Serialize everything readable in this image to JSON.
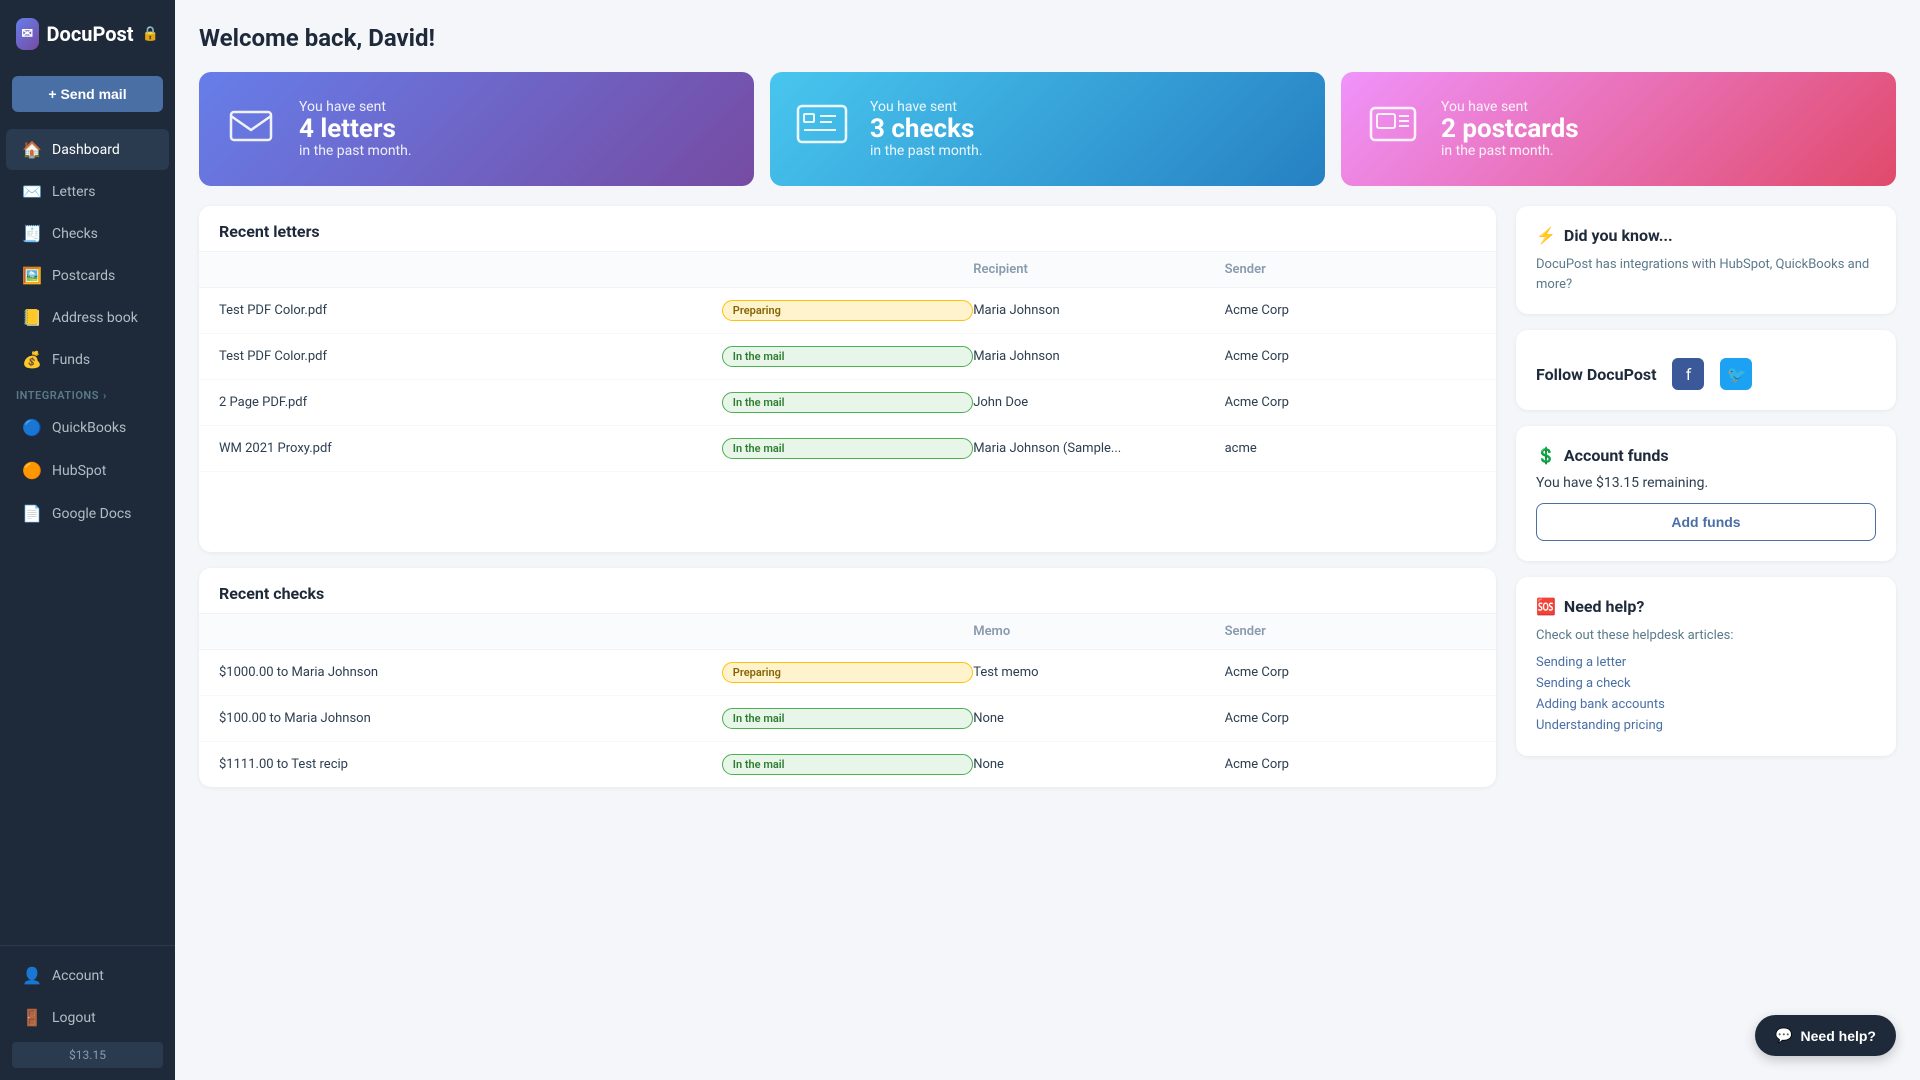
{
  "app": {
    "name": "DocuPost",
    "logo_text": "DocuPost"
  },
  "sidebar": {
    "send_mail_label": "+ Send mail",
    "nav_items": [
      {
        "id": "dashboard",
        "label": "Dashboard",
        "icon": "🏠",
        "active": true
      },
      {
        "id": "letters",
        "label": "Letters",
        "icon": "✉️",
        "active": false
      },
      {
        "id": "checks",
        "label": "Checks",
        "icon": "🧾",
        "active": false
      },
      {
        "id": "postcards",
        "label": "Postcards",
        "icon": "🖼️",
        "active": false
      },
      {
        "id": "address-book",
        "label": "Address book",
        "icon": "📒",
        "active": false
      },
      {
        "id": "funds",
        "label": "Funds",
        "icon": "💰",
        "active": false
      }
    ],
    "integrations_label": "INTEGRATIONS",
    "integration_items": [
      {
        "id": "quickbooks",
        "label": "QuickBooks",
        "icon": "🔵"
      },
      {
        "id": "hubspot",
        "label": "HubSpot",
        "icon": "🟠"
      },
      {
        "id": "google-docs",
        "label": "Google Docs",
        "icon": "📄"
      }
    ],
    "bottom_items": [
      {
        "id": "account",
        "label": "Account",
        "icon": "👤"
      },
      {
        "id": "logout",
        "label": "Logout",
        "icon": "🚪"
      }
    ],
    "balance": "$13.15"
  },
  "header": {
    "welcome_text": "Welcome back, David!"
  },
  "stats": [
    {
      "id": "letters",
      "type": "letters",
      "prefix": "You have sent",
      "count": "4 letters",
      "suffix": "in the past month.",
      "icon": "✈️"
    },
    {
      "id": "checks",
      "type": "checks",
      "prefix": "You have sent",
      "count": "3 checks",
      "suffix": "in the past month.",
      "icon": "🏛️"
    },
    {
      "id": "postcards",
      "type": "postcards",
      "prefix": "You have sent",
      "count": "2 postcards",
      "suffix": "in the past month.",
      "icon": "🖼️"
    }
  ],
  "recent_letters": {
    "title": "Recent letters",
    "columns": [
      "",
      "",
      "Recipient",
      "Sender"
    ],
    "rows": [
      {
        "name": "Test PDF Color.pdf",
        "status": "Preparing",
        "status_type": "preparing",
        "recipient": "Maria Johnson",
        "sender": "Acme Corp"
      },
      {
        "name": "Test PDF Color.pdf",
        "status": "In the mail",
        "status_type": "inmail",
        "recipient": "Maria Johnson",
        "sender": "Acme Corp"
      },
      {
        "name": "2 Page PDF.pdf",
        "status": "In the mail",
        "status_type": "inmail",
        "recipient": "John Doe",
        "sender": "Acme Corp"
      },
      {
        "name": "WM 2021 Proxy.pdf",
        "status": "In the mail",
        "status_type": "inmail",
        "recipient": "Maria Johnson (Sample...",
        "sender": "acme"
      }
    ]
  },
  "recent_checks": {
    "title": "Recent checks",
    "columns": [
      "",
      "",
      "Memo",
      "Sender"
    ],
    "rows": [
      {
        "name": "$1000.00 to Maria Johnson",
        "status": "Preparing",
        "status_type": "preparing",
        "memo": "Test memo",
        "sender": "Acme Corp"
      },
      {
        "name": "$100.00 to Maria Johnson",
        "status": "In the mail",
        "status_type": "inmail",
        "memo": "None",
        "sender": "Acme Corp"
      },
      {
        "name": "$1111.00 to Test recip",
        "status": "In the mail",
        "status_type": "inmail",
        "memo": "None",
        "sender": "Acme Corp"
      }
    ]
  },
  "did_you_know": {
    "title": "Did you know...",
    "text": "DocuPost has integrations with HubSpot, QuickBooks and more?"
  },
  "follow": {
    "label": "Follow DocuPost"
  },
  "account_funds": {
    "title": "Account funds",
    "remaining_text": "You have $13.15 remaining.",
    "add_funds_label": "Add funds"
  },
  "need_help": {
    "title": "Need help?",
    "intro": "Check out these helpdesk articles:",
    "articles": [
      "Sending a letter",
      "Sending a check",
      "Adding bank accounts",
      "Understanding pricing"
    ]
  },
  "chat_button": {
    "label": "Need help?"
  }
}
